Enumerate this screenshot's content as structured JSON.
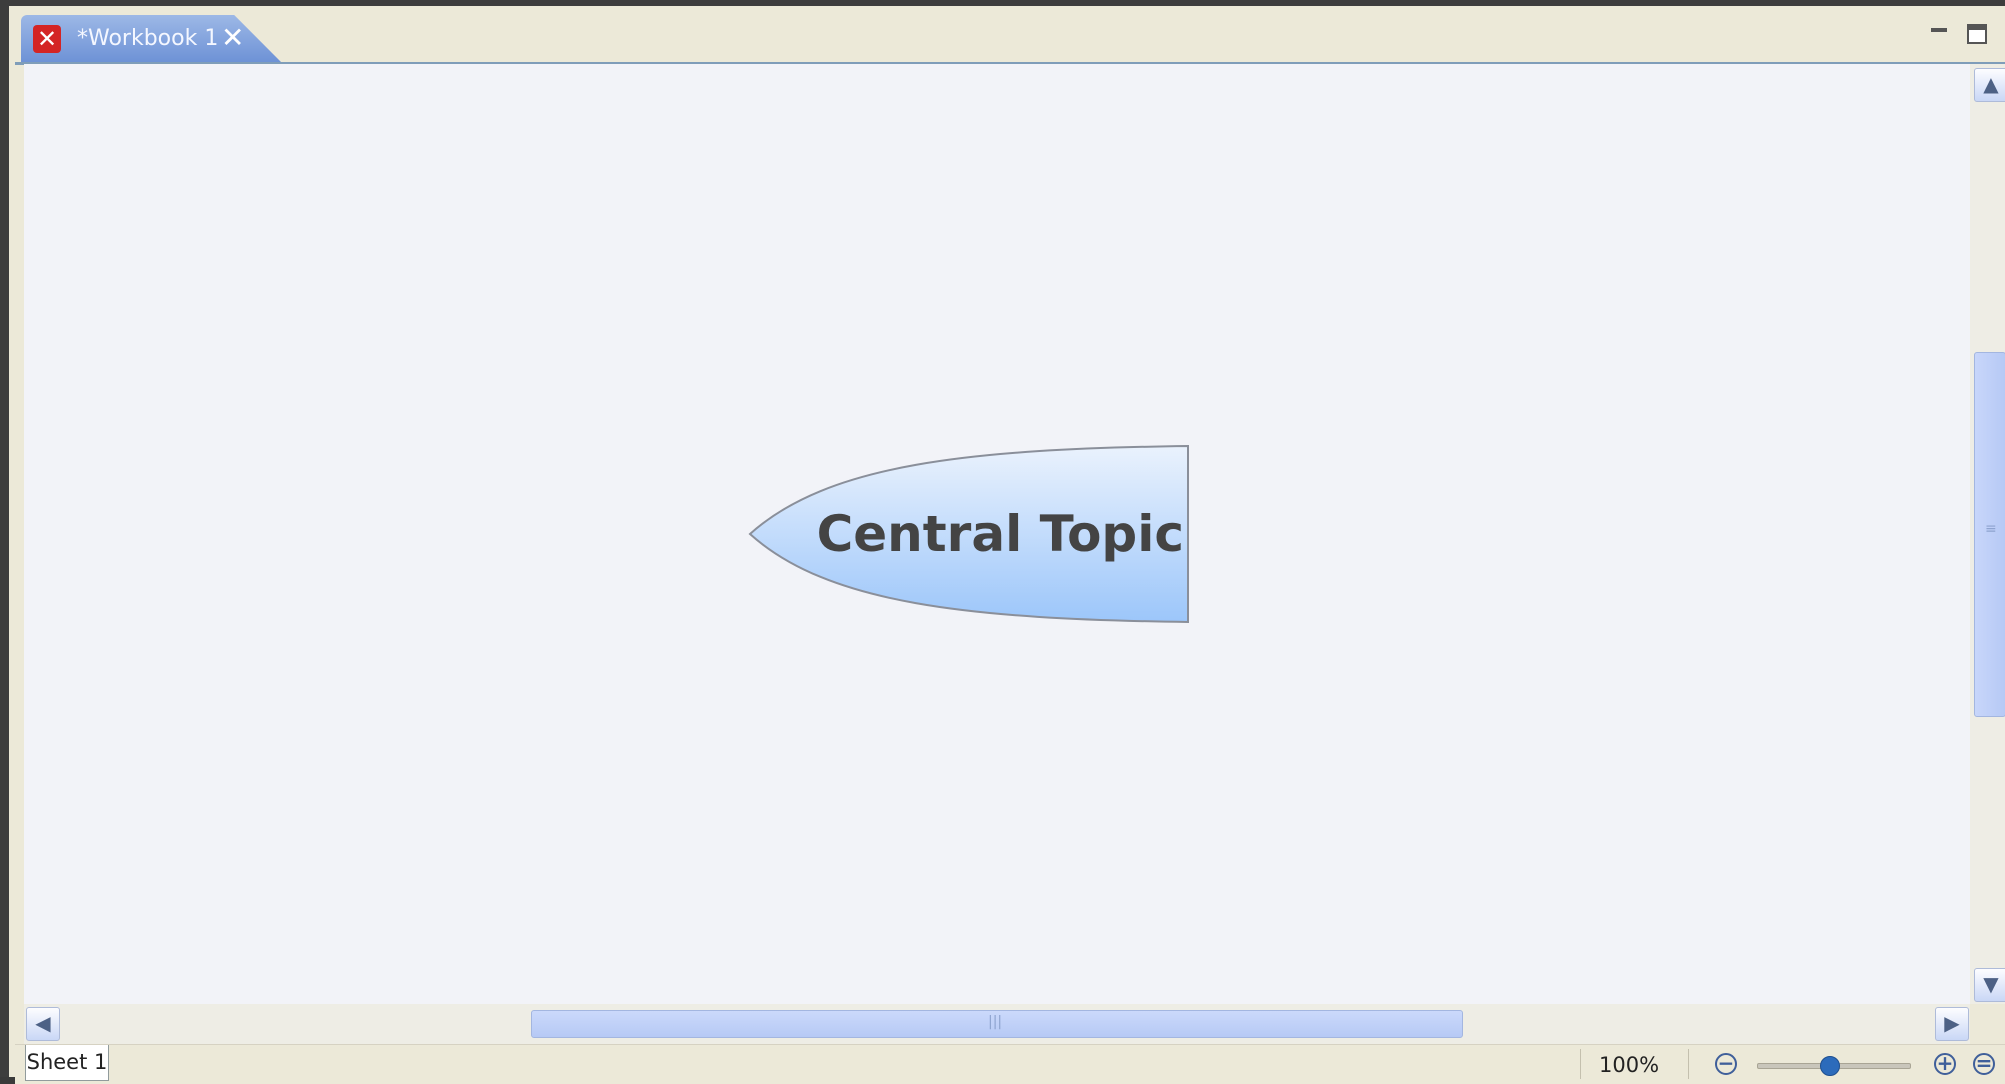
{
  "window": {
    "tab_title": "*Workbook 1",
    "tab_icon": "xmind-app-icon",
    "close_symbol": "✕"
  },
  "canvas": {
    "central_topic": "Central Topic",
    "topic_fill_top": "#e8f1fd",
    "topic_fill_bottom": "#9cc8fb",
    "background": "#f2f3f8"
  },
  "status": {
    "sheet_tab": "Sheet 1",
    "zoom": "100%",
    "zoom_out_symbol": "−",
    "zoom_in_symbol": "+",
    "zoom_fit_symbol": "="
  },
  "scrollbars": {
    "up": "▲",
    "down": "▼",
    "left": "◀",
    "right": "▶"
  }
}
